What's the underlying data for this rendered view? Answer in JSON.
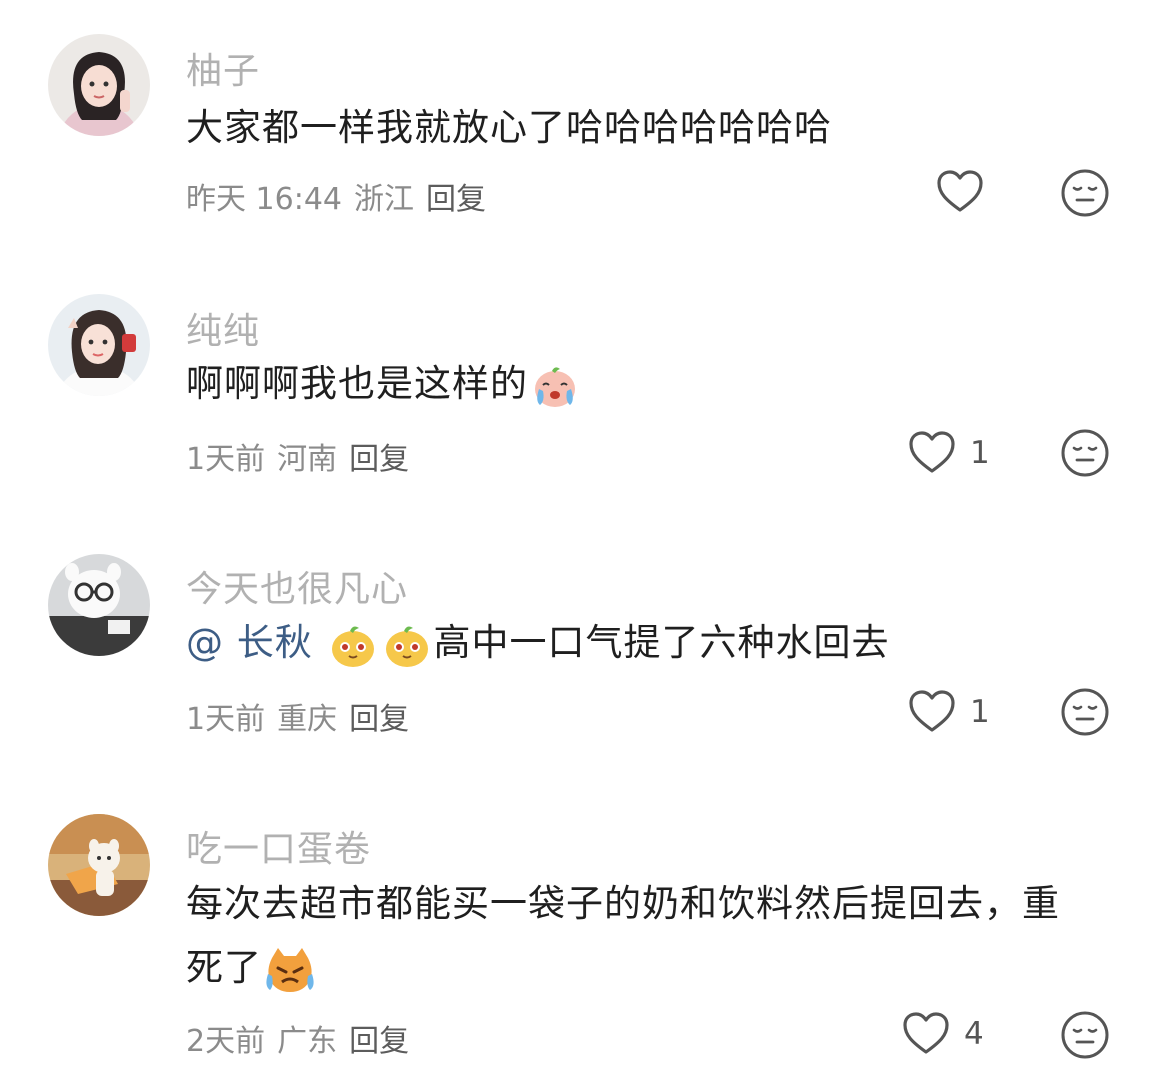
{
  "comments": [
    {
      "username": "柚子",
      "text": "大家都一样我就放心了哈哈哈哈哈哈哈",
      "time": "昨天 16:44",
      "location": "浙江",
      "reply": "回复",
      "likes": ""
    },
    {
      "username": "纯纯",
      "text": "啊啊啊我也是这样的",
      "emoji": "crying-face-emoji",
      "time": "1天前",
      "location": "河南",
      "reply": "回复",
      "likes": "1"
    },
    {
      "username": "今天也很凡心",
      "mention": "@ 长秋",
      "text": "高中一口气提了六种水回去",
      "emoji": "blushing-face-emoji",
      "time": "1天前",
      "location": "重庆",
      "reply": "回复",
      "likes": "1"
    },
    {
      "username": "吃一口蛋卷",
      "text_line1": "每次去超市都能买一袋子的奶和饮料然后提回去，重",
      "text_line2": "死了",
      "emoji": "angry-cat-emoji",
      "time": "2天前",
      "location": "广东",
      "reply": "回复",
      "likes": "4"
    }
  ],
  "icons": {
    "like": "heart-outline-icon",
    "dislike": "meh-face-icon"
  }
}
